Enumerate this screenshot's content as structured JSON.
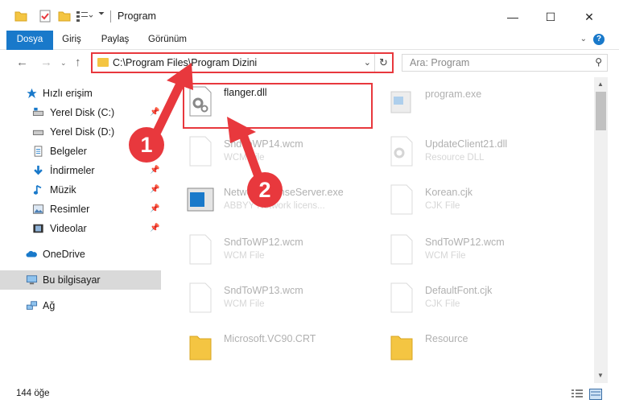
{
  "window": {
    "title": "Program",
    "minimize": "—",
    "maximize": "☐",
    "close": "✕"
  },
  "ribbon": {
    "tabs": [
      "Dosya",
      "Giriş",
      "Paylaş",
      "Görünüm"
    ],
    "help": "?"
  },
  "address": {
    "path": "C:\\Program Files\\Program Dizini"
  },
  "search": {
    "placeholder": "Ara: Program"
  },
  "sidebar": {
    "quick_access": "Hızlı erişim",
    "items": [
      {
        "label": "Yerel Disk (C:)",
        "icon": "drive-icon",
        "pinned": true
      },
      {
        "label": "Yerel Disk (D:)",
        "icon": "drive-icon",
        "pinned": false
      },
      {
        "label": "Belgeler",
        "icon": "documents-icon",
        "pinned": true
      },
      {
        "label": "İndirmeler",
        "icon": "download-icon",
        "pinned": true
      },
      {
        "label": "Müzik",
        "icon": "music-icon",
        "pinned": true
      },
      {
        "label": "Resimler",
        "icon": "pictures-icon",
        "pinned": true
      },
      {
        "label": "Videolar",
        "icon": "videos-icon",
        "pinned": true
      }
    ],
    "onedrive": "OneDrive",
    "this_pc": "Bu bilgisayar",
    "network": "Ağ"
  },
  "files": [
    {
      "name": "flanger.dll",
      "type": "",
      "icon": "dll-gear-icon"
    },
    {
      "name": "program.exe",
      "type": "",
      "icon": "exe-icon"
    },
    {
      "name": "SndToWP14.wcm",
      "type": "WCM File",
      "icon": "file-icon"
    },
    {
      "name": "UpdateClient21.dll",
      "type": "Resource DLL",
      "icon": "dll-gear-icon"
    },
    {
      "name": "NetworkLicenseServer.exe",
      "type": "ABBYY Network licens...",
      "icon": "exe-window-icon"
    },
    {
      "name": "Korean.cjk",
      "type": "CJK File",
      "icon": "file-icon"
    },
    {
      "name": "SndToWP12.wcm",
      "type": "WCM File",
      "icon": "file-icon"
    },
    {
      "name": "SndToWP12.wcm",
      "type": "WCM File",
      "icon": "file-icon"
    },
    {
      "name": "SndToWP13.wcm",
      "type": "WCM File",
      "icon": "file-icon"
    },
    {
      "name": "DefaultFont.cjk",
      "type": "CJK File",
      "icon": "file-icon"
    },
    {
      "name": "Microsoft.VC90.CRT",
      "type": "",
      "icon": "folder-icon"
    },
    {
      "name": "Resource",
      "type": "",
      "icon": "folder-icon"
    }
  ],
  "status": {
    "count": "144 öğe"
  },
  "callouts": [
    "1",
    "2"
  ],
  "colors": {
    "accent": "#1979ca",
    "highlight": "#e8383d",
    "selection": "#d9d9d9"
  }
}
